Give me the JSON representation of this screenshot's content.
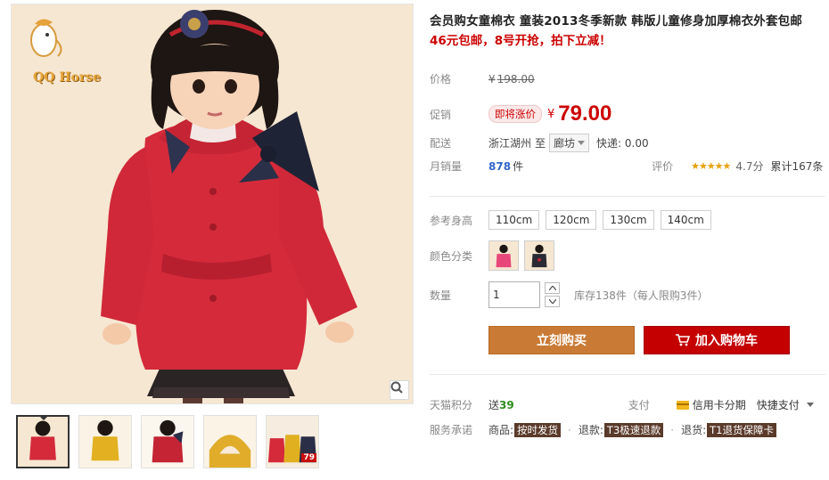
{
  "brand": {
    "logo_text": "QQ Horse"
  },
  "gallery": {
    "thumbnails": [
      {
        "name": "thumb-red-front",
        "active": true
      },
      {
        "name": "thumb-yellow"
      },
      {
        "name": "thumb-red-side"
      },
      {
        "name": "thumb-yellow-hood"
      },
      {
        "name": "thumb-combo",
        "badge": "79"
      }
    ]
  },
  "product": {
    "title": "会员购女童棉衣 童装2013冬季新款 韩版儿童修身加厚棉衣外套包邮",
    "promo_line": "46元包邮，8号开抢，拍下立减！"
  },
  "price": {
    "label": "价格",
    "currency": "¥",
    "original": "198.00"
  },
  "promotion": {
    "label": "促销",
    "tag": "即将涨价",
    "currency": "¥",
    "price": "79.00"
  },
  "shipping": {
    "label": "配送",
    "from": "浙江湖州",
    "to_label": "至",
    "destination": "廊坊",
    "fee": "快递: 0.00"
  },
  "sales": {
    "label": "月销量",
    "count": "878",
    "unit": "件",
    "rating_label": "评价",
    "stars": "★★★★★",
    "score": "4.7分",
    "reviews": "累计167条"
  },
  "size": {
    "label": "参考身高",
    "options": [
      "110cm",
      "120cm",
      "130cm",
      "140cm"
    ]
  },
  "color": {
    "label": "颜色分类",
    "swatches": [
      "pink-coat",
      "black-coat"
    ]
  },
  "quantity": {
    "label": "数量",
    "value": "1",
    "stock": "库存138件（每人限购3件）"
  },
  "actions": {
    "buy_now": "立刻购买",
    "add_to_cart": "加入购物车"
  },
  "points": {
    "label": "天猫积分",
    "send": "送",
    "value": "39",
    "pay_label": "支付",
    "installment": "信用卡分期",
    "quick_pay": "快捷支付"
  },
  "promise": {
    "label": "服务承诺",
    "items": [
      {
        "key": "商品:",
        "tag": "按时发货"
      },
      {
        "key": "退款:",
        "tag": "T3极速退款"
      },
      {
        "key": "退货:",
        "tag": "T1退货保障卡"
      }
    ]
  },
  "colors": {
    "accent_red": "#c40000",
    "buy_button": "#c97a34",
    "price_red": "#cc0000",
    "stars": "#e7a100"
  }
}
